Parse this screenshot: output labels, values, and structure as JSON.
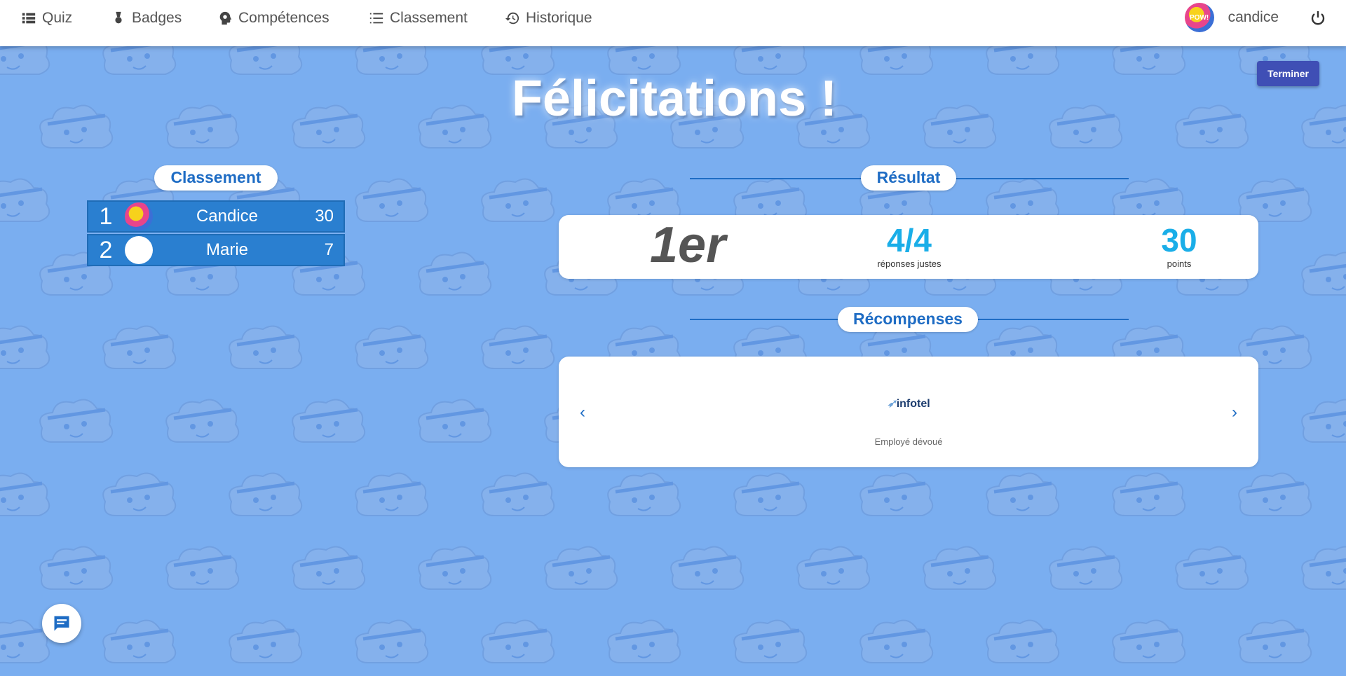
{
  "nav": {
    "items": [
      {
        "label": "Quiz",
        "icon": "list-icon"
      },
      {
        "label": "Badges",
        "icon": "medal-icon"
      },
      {
        "label": "Compétences",
        "icon": "head-gear-icon"
      },
      {
        "label": "Classement",
        "icon": "ranking-list-icon"
      },
      {
        "label": "Historique",
        "icon": "history-icon"
      }
    ],
    "user_name": "candice",
    "avatar_text": "POW!"
  },
  "actions": {
    "finish_label": "Terminer"
  },
  "title": "Félicitations !",
  "ranking": {
    "heading": "Classement",
    "rows": [
      {
        "pos": "1",
        "name": "Candice",
        "score": "30"
      },
      {
        "pos": "2",
        "name": "Marie",
        "score": "7"
      }
    ]
  },
  "result": {
    "heading": "Résultat",
    "rank": "1er",
    "answers_value": "4/4",
    "answers_label": "réponses justes",
    "points_value": "30",
    "points_label": "points"
  },
  "rewards": {
    "heading": "Récompenses",
    "logo_text": "infotel",
    "badge_label": "Employé dévoué",
    "prev_arrow": "‹",
    "next_arrow": "›"
  },
  "colors": {
    "background": "#7aaef0",
    "accent": "#1e6cc4",
    "button": "#3f4fb5",
    "stat": "#1aaee8"
  }
}
